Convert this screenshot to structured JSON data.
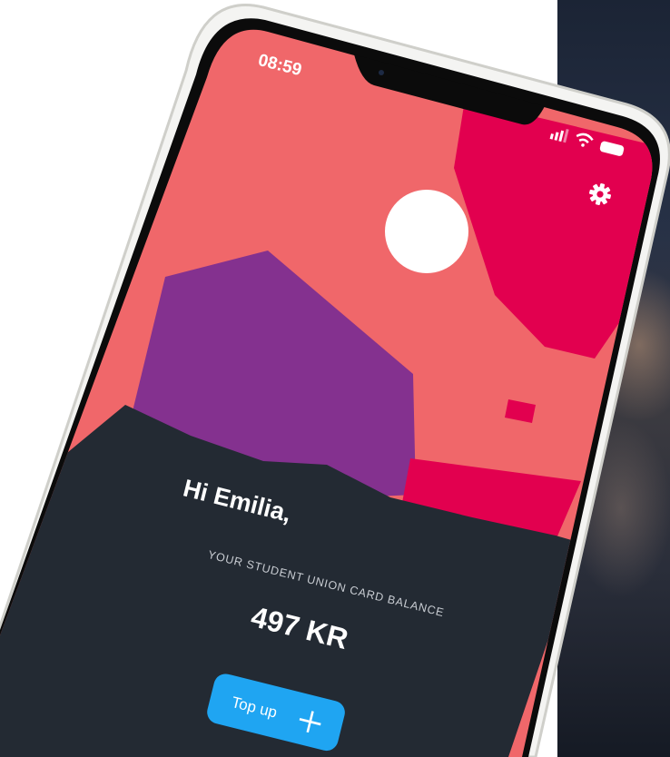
{
  "status_bar": {
    "time": "08:59"
  },
  "home": {
    "greeting": "Hi Emilia,",
    "balance_caption": "YOUR STUDENT UNION CARD BALANCE",
    "balance": "497 KR",
    "top_up_label": "Top up",
    "top_up_icon": "plus-icon",
    "settings_icon": "gear-icon"
  },
  "colors": {
    "sky": "#F0676A",
    "dark": "#232A33",
    "mountain": "#84318F",
    "balloon": "#E2004F",
    "button": "#1FA5F2"
  }
}
